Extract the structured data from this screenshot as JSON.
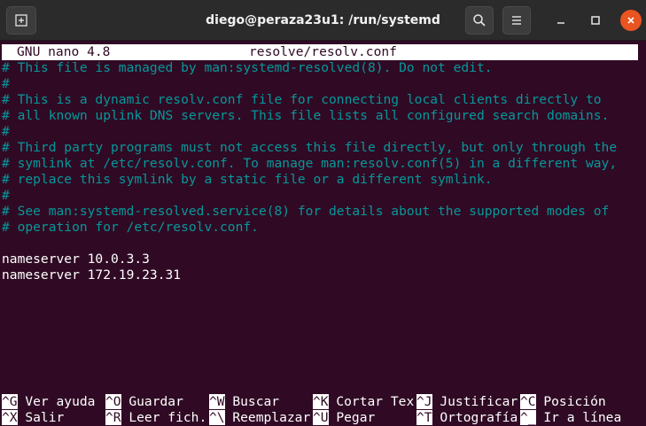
{
  "window": {
    "title": "diego@peraza23u1: /run/systemd"
  },
  "nano": {
    "version_label": "GNU nano 4.8",
    "filename": "resolve/resolv.conf"
  },
  "file_lines": [
    {
      "text": "# This file is managed by man:systemd-resolved(8). Do not edit.",
      "kind": "comment"
    },
    {
      "text": "#",
      "kind": "comment"
    },
    {
      "text": "# This is a dynamic resolv.conf file for connecting local clients directly to",
      "kind": "comment"
    },
    {
      "text": "# all known uplink DNS servers. This file lists all configured search domains.",
      "kind": "comment"
    },
    {
      "text": "#",
      "kind": "comment"
    },
    {
      "text": "# Third party programs must not access this file directly, but only through the",
      "kind": "comment"
    },
    {
      "text": "# symlink at /etc/resolv.conf. To manage man:resolv.conf(5) in a different way,",
      "kind": "comment"
    },
    {
      "text": "# replace this symlink by a static file or a different symlink.",
      "kind": "comment"
    },
    {
      "text": "#",
      "kind": "comment"
    },
    {
      "text": "# See man:systemd-resolved.service(8) for details about the supported modes of",
      "kind": "comment"
    },
    {
      "text": "# operation for /etc/resolv.conf.",
      "kind": "comment"
    },
    {
      "text": "",
      "kind": "normal"
    },
    {
      "text": "nameserver 10.0.3.3",
      "kind": "normal"
    },
    {
      "text": "nameserver 172.19.23.31",
      "kind": "normal"
    }
  ],
  "shortcuts": {
    "row1": [
      {
        "key": "^G",
        "label": " Ver ayuda"
      },
      {
        "key": "^O",
        "label": " Guardar"
      },
      {
        "key": "^W",
        "label": " Buscar"
      },
      {
        "key": "^K",
        "label": " Cortar Tex"
      },
      {
        "key": "^J",
        "label": " Justificar"
      },
      {
        "key": "^C",
        "label": " Posición"
      }
    ],
    "row2": [
      {
        "key": "^X",
        "label": " Salir"
      },
      {
        "key": "^R",
        "label": " Leer fich."
      },
      {
        "key": "^\\",
        "label": " Reemplazar"
      },
      {
        "key": "^U",
        "label": " Pegar"
      },
      {
        "key": "^T",
        "label": " Ortografía"
      },
      {
        "key": "^_",
        "label": " Ir a línea"
      }
    ]
  },
  "icons": {
    "new_tab": "new-tab-icon",
    "search": "search-icon",
    "menu": "hamburger-menu-icon",
    "minimize": "minimize-icon",
    "maximize": "maximize-icon",
    "close": "close-icon"
  },
  "colors": {
    "background": "#300a24",
    "comment": "#06989a",
    "text": "#ffffff",
    "close_button": "#e95420"
  }
}
